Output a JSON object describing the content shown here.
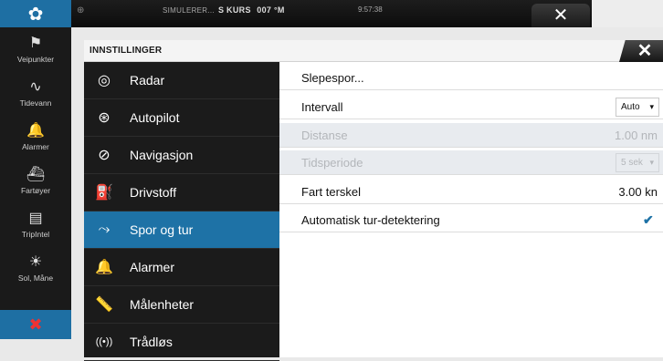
{
  "topbar": {
    "status": "SIMULERER...",
    "course_label": "S KURS",
    "course_value": "007 °M",
    "time": "9:57:38",
    "close_glyph": "✕",
    "settings_glyph": "✿"
  },
  "sidebar": {
    "items": [
      {
        "label": "Veipunkter",
        "icon": "flag-icon",
        "glyph": "⚑"
      },
      {
        "label": "Tidevann",
        "icon": "wave-icon",
        "glyph": "∿"
      },
      {
        "label": "Alarmer",
        "icon": "bell-icon",
        "glyph": "🔔"
      },
      {
        "label": "Fartøyer",
        "icon": "vessel-icon",
        "glyph": "⛴"
      },
      {
        "label": "TripIntel",
        "icon": "trip-icon",
        "glyph": "▤"
      },
      {
        "label": "Sol, Måne",
        "icon": "sun-icon",
        "glyph": "☀"
      }
    ],
    "close_glyph": "✖"
  },
  "dialog": {
    "title": "INNSTILLINGER",
    "close_glyph": "✕",
    "categories": [
      {
        "label": "Radar",
        "icon": "radar-icon",
        "glyph": "◎"
      },
      {
        "label": "Autopilot",
        "icon": "steering-wheel-icon",
        "glyph": "⊛"
      },
      {
        "label": "Navigasjon",
        "icon": "compass-icon",
        "glyph": "⊘"
      },
      {
        "label": "Drivstoff",
        "icon": "fuel-icon",
        "glyph": "⛽"
      },
      {
        "label": "Spor og tur",
        "icon": "track-icon",
        "glyph": "⤳",
        "active": true
      },
      {
        "label": "Alarmer",
        "icon": "bell-icon",
        "glyph": "🔔"
      },
      {
        "label": "Målenheter",
        "icon": "ruler-icon",
        "glyph": "📏"
      },
      {
        "label": "Trådløs",
        "icon": "wireless-icon",
        "glyph": "((•))"
      }
    ],
    "rows": [
      {
        "label": "Slepespor..."
      },
      {
        "label": "Intervall",
        "dropdown": "Auto"
      },
      {
        "label": "Distanse",
        "value": "1.00 nm",
        "disabled": true
      },
      {
        "label": "Tidsperiode",
        "dropdown": "5 sek",
        "disabled": true
      },
      {
        "label": "Fart terskel",
        "value": "3.00 kn"
      },
      {
        "label": "Automatisk tur-detektering",
        "checked": true
      }
    ],
    "checkmark": "✔",
    "dropdown_arrow": "▾"
  },
  "colors": {
    "accent": "#1e72a6",
    "sidebar_bg": "#1a1a1a",
    "disabled_text": "#b3b6ba"
  }
}
